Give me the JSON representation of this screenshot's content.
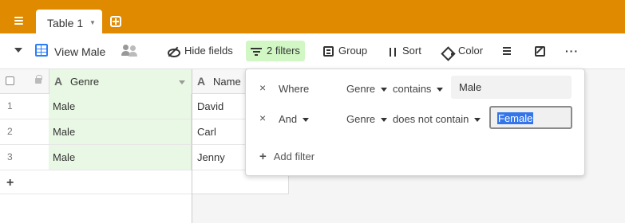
{
  "tab": {
    "label": "Table 1"
  },
  "toolbar": {
    "view_name": "View Male",
    "hide_fields": "Hide fields",
    "filters": "2 filters",
    "group": "Group",
    "sort": "Sort",
    "color": "Color",
    "more": "···"
  },
  "grid": {
    "columns": [
      "Genre",
      "Name"
    ],
    "rows": [
      {
        "num": "1",
        "genre": "Male",
        "name": "David"
      },
      {
        "num": "2",
        "genre": "Male",
        "name": "Carl"
      },
      {
        "num": "3",
        "genre": "Male",
        "name": "Jenny"
      }
    ],
    "add_row": "+"
  },
  "filter_popover": {
    "conditions": [
      {
        "remove": "×",
        "conjunction": "Where",
        "field": "Genre",
        "operator": "contains",
        "value": "Male"
      },
      {
        "remove": "×",
        "conjunction": "And",
        "field": "Genre",
        "operator": "does not contain",
        "value": "Female"
      }
    ],
    "add_filter": "Add filter",
    "add_filter_plus": "+"
  },
  "colors": {
    "topbar": "#e08a00",
    "filter_active": "#d1f7c4",
    "filtered_column": "#e9f8e4",
    "grid_icon": "#2d7ff9",
    "selection": "#3476ea"
  }
}
